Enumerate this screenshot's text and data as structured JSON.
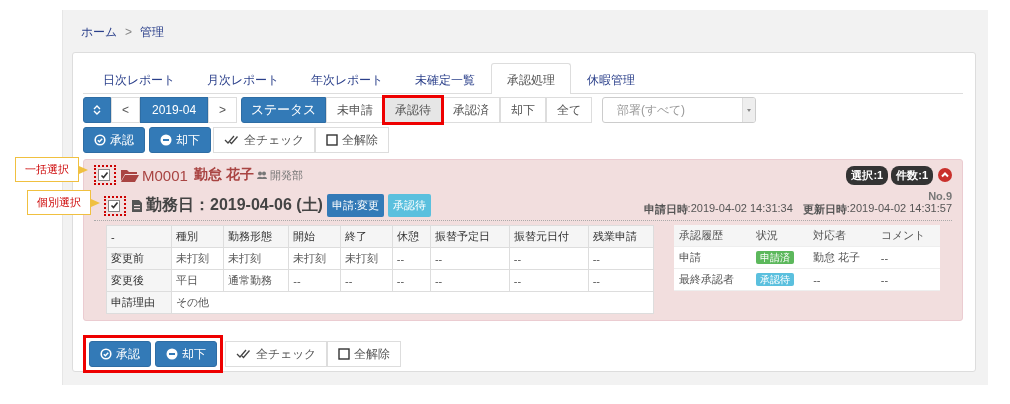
{
  "breadcrumb": [
    {
      "label": "ホーム"
    },
    {
      "label": "管理"
    }
  ],
  "breadcrumb_separator": ">",
  "tabs": [
    {
      "label": "日次レポート",
      "selected": false
    },
    {
      "label": "月次レポート",
      "selected": false
    },
    {
      "label": "年次レポート",
      "selected": false
    },
    {
      "label": "未確定一覧",
      "selected": false
    },
    {
      "label": "承認処理",
      "selected": true
    },
    {
      "label": "休暇管理",
      "selected": false
    }
  ],
  "toolbar": {
    "prev": "<",
    "month": "2019-04",
    "next": ">",
    "status_label": "ステータス",
    "status_filters": [
      {
        "label": "未申請",
        "selected": false,
        "highlighted": false
      },
      {
        "label": "承認待",
        "selected": true,
        "highlighted": true
      },
      {
        "label": "承認済",
        "selected": false,
        "highlighted": false
      },
      {
        "label": "却下",
        "selected": false,
        "highlighted": false
      },
      {
        "label": "全て",
        "selected": false,
        "highlighted": false
      }
    ],
    "department_select": {
      "placeholder": "部署(すべて)"
    }
  },
  "actions_top": {
    "highlighted": false,
    "buttons": [
      {
        "kind": "approve",
        "label": "承認"
      },
      {
        "kind": "reject",
        "label": "却下"
      },
      {
        "kind": "check_all",
        "label": "全チェック"
      },
      {
        "kind": "uncheck_all",
        "label": "全解除"
      }
    ]
  },
  "group": {
    "checked": true,
    "annotated": true,
    "code": "M0001",
    "name": "勤怠 花子",
    "department": "開発部",
    "badges": [
      "選択:1",
      "件数:1"
    ],
    "expanded": true,
    "entry": {
      "checked": true,
      "annotated": true,
      "title": "勤務日：2019-04-06 (土)",
      "tags": [
        {
          "label": "申請:変更",
          "color": "#337ab7"
        },
        {
          "label": "承認待",
          "color": "#5bc0de"
        }
      ],
      "number": "No.9",
      "applied_label": "申請日時",
      "applied": ":2019-04-02 14:31:34",
      "updated_label": "更新日時",
      "updated": ":2019-04-02 14:31:57",
      "detail_table": {
        "columns": [
          "-",
          "種別",
          "勤務形態",
          "開始",
          "終了",
          "休憩",
          "振替予定日",
          "振替元日付",
          "残業申請"
        ],
        "rows": [
          [
            "変更前",
            "未打刻",
            "未打刻",
            "未打刻",
            "未打刻",
            "--",
            "--",
            "--",
            "--"
          ],
          [
            "変更後",
            "平日",
            "通常勤務",
            "--",
            "--",
            "--",
            "--",
            "--",
            "--"
          ]
        ],
        "reason_label": "申請理由",
        "reason": "その他"
      },
      "history_table": {
        "columns": [
          "承認履歴",
          "状況",
          "対応者",
          "コメント"
        ],
        "rows": [
          {
            "step": "申請",
            "status": {
              "label": "申請済",
              "color": "#5cb85c"
            },
            "person": "勤怠 花子",
            "comment": "--"
          },
          {
            "step": "最終承認者",
            "status": {
              "label": "承認待",
              "color": "#5bc0de"
            },
            "person": "--",
            "comment": "--"
          }
        ]
      }
    }
  },
  "actions_bottom": {
    "highlighted": true,
    "buttons": [
      {
        "kind": "approve",
        "label": "承認"
      },
      {
        "kind": "reject",
        "label": "却下"
      },
      {
        "kind": "check_all",
        "label": "全チェック"
      },
      {
        "kind": "uncheck_all",
        "label": "全解除"
      }
    ]
  },
  "annotations": [
    {
      "label": "一括選択"
    },
    {
      "label": "個別選択"
    }
  ]
}
